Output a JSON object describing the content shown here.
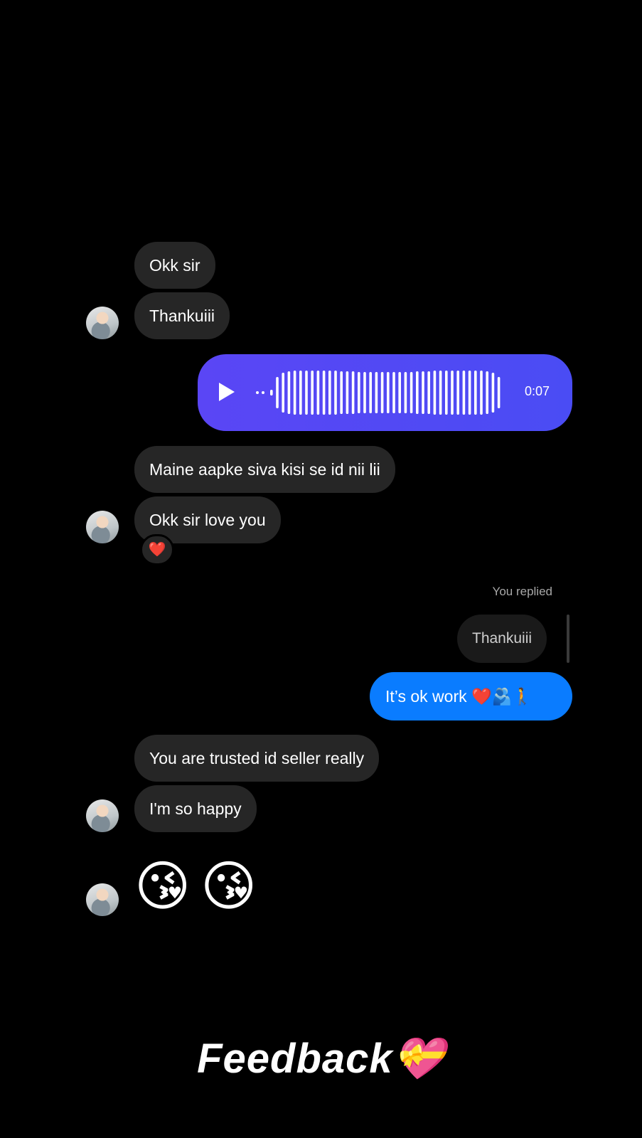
{
  "messages": {
    "m1": "Okk sir",
    "m2": "Thankuiii",
    "voice_duration": "0:07",
    "m3": "Maine aapke siva kisi se id nii lii",
    "m4": "Okk sir love you",
    "m4_reaction": "❤️",
    "replied_label": "You replied",
    "reply_quote": "Thankuiii",
    "out_message": "It’s ok work ❤️🫂🚶",
    "m5": "You are trusted id seller really",
    "m6": "I'm so happy",
    "emoji_1": "😘",
    "emoji_2": "😘"
  },
  "overlay": {
    "feedback_text": "Feedback💝"
  },
  "colors": {
    "incoming_bubble": "#262626",
    "outgoing_bubble": "#0a7cff",
    "voice_bubble": "#5a46f5",
    "background": "#000000"
  }
}
